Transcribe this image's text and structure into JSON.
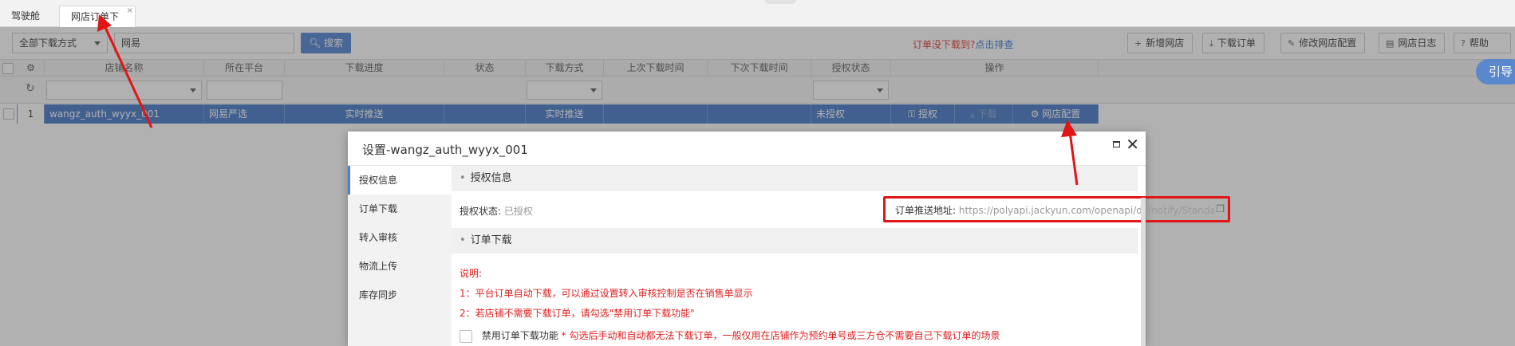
{
  "tabs": [
    {
      "label": "驾驶舱"
    },
    {
      "label": "网店订单下载",
      "close": "×"
    }
  ],
  "toolbar": {
    "download_mode": "全部下载方式",
    "search_value": "网易",
    "search_label": "搜索",
    "notice_text": "订单没下载到?",
    "notice_link": "点击排查",
    "buttons": [
      {
        "label": "新增网店",
        "icon": "plus-icon"
      },
      {
        "label": "下载订单",
        "icon": "download-icon"
      },
      {
        "label": "修改网店配置",
        "icon": "edit-icon"
      },
      {
        "label": "网店日志",
        "icon": "document-icon"
      },
      {
        "label": "帮助",
        "icon": "help-icon"
      }
    ]
  },
  "grid": {
    "headers": [
      "店铺名称",
      "所在平台",
      "下载进度",
      "状态",
      "下载方式",
      "上次下载时间",
      "下次下载时间",
      "授权状态",
      "操作"
    ],
    "row": {
      "index": "1",
      "shop": "wangz_auth_wyyx_001",
      "platform": "网易严选",
      "progress": "实时推送",
      "status": "",
      "mode": "实时推送",
      "last_time": "",
      "next_time": "",
      "auth": "未授权",
      "op_auth": "授权",
      "op_download": "下载",
      "op_config": "网店配置"
    }
  },
  "guide_label": "引导",
  "dialog": {
    "title": "设置-wangz_auth_wyyx_001",
    "nav": [
      "授权信息",
      "订单下载",
      "转入审核",
      "物流上传",
      "库存同步"
    ],
    "sections": {
      "auth_title": "授权信息",
      "auth_status_label": "授权状态:",
      "auth_status_value": "已授权",
      "url_label": "订单推送地址:",
      "url_value": "https://polyapi.jackyun.com/openapi/do/notify/Standard",
      "download_title": "订单下载",
      "notes": [
        "说明:",
        "1：平台订单自动下载，可以通过设置转入审核控制是否在销售单显示",
        "2：若店铺不需要下载订单，请勾选\"禁用订单下载功能\""
      ],
      "disable_label": "禁用订单下载功能",
      "disable_note": "* 勾选后手动和自动都无法下载订单，一般仅用在店铺作为预约单号或三方仓不需要自己下载订单的场景"
    }
  },
  "colors": {
    "accent": "#4a7fd0",
    "selected_row": "#3f72c4",
    "highlight": "#e01515"
  }
}
